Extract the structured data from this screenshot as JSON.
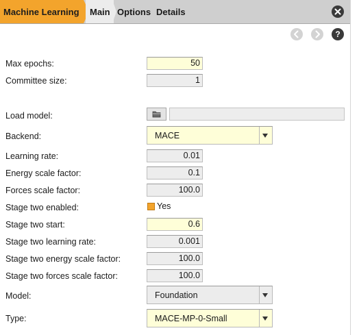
{
  "breadcrumb": {
    "root": "Machine Learning"
  },
  "tabs": [
    "Main",
    "Options",
    "Details"
  ],
  "icons": {
    "close": "close-icon",
    "prev": "chevron-left-icon",
    "next": "chevron-right-icon",
    "help": "?"
  },
  "colors": {
    "accent": "#f3a42c",
    "editable": "#fefed8",
    "readonly": "#ededed"
  },
  "form": {
    "max_epochs": {
      "label": "Max epochs:",
      "value": "50"
    },
    "committee_size": {
      "label": "Committee size:",
      "value": "1"
    },
    "load_model": {
      "label": "Load model:",
      "value": ""
    },
    "backend": {
      "label": "Backend:",
      "value": "MACE"
    },
    "learning_rate": {
      "label": "Learning rate:",
      "value": "0.01"
    },
    "energy_scale": {
      "label": "Energy scale factor:",
      "value": "0.1"
    },
    "forces_scale": {
      "label": "Forces scale factor:",
      "value": "100.0"
    },
    "stage_two_enabled": {
      "label": "Stage two enabled:",
      "value": "Yes"
    },
    "stage_two_start": {
      "label": "Stage two start:",
      "value": "0.6"
    },
    "stage_two_lr": {
      "label": "Stage two learning rate:",
      "value": "0.001"
    },
    "stage_two_energy": {
      "label": "Stage two energy scale factor:",
      "value": "100.0"
    },
    "stage_two_forces": {
      "label": "Stage two forces scale factor:",
      "value": "100.0"
    },
    "model": {
      "label": "Model:",
      "value": "Foundation"
    },
    "type": {
      "label": "Type:",
      "value": "MACE-MP-0-Small"
    }
  }
}
